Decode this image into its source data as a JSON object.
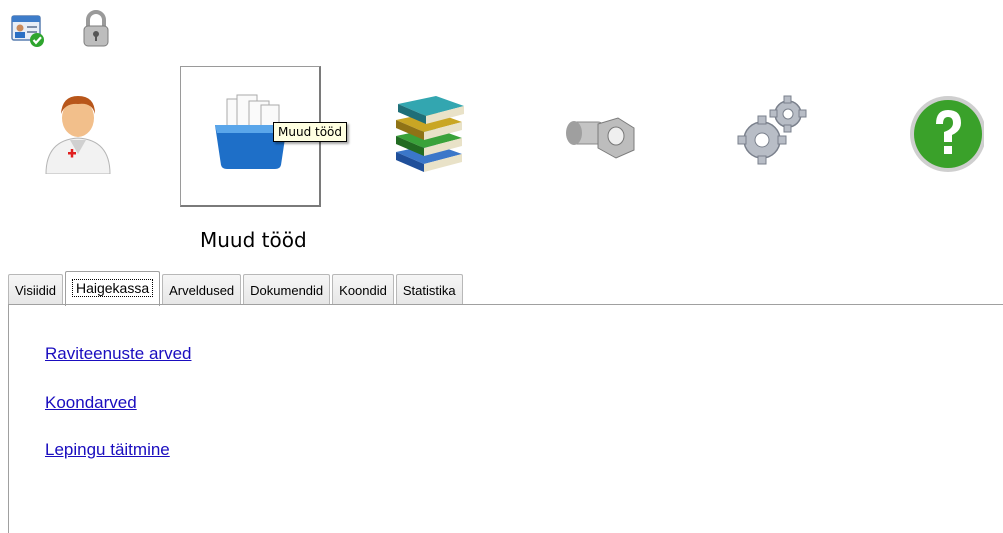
{
  "toolbar": {
    "small_icons": [
      "patient-card-icon",
      "lock-icon"
    ],
    "tiles": [
      {
        "name": "doctor-icon",
        "selected": false
      },
      {
        "name": "folder-icon",
        "selected": true
      },
      {
        "name": "books-icon",
        "selected": false
      },
      {
        "name": "bolt-nut-icon",
        "selected": false
      },
      {
        "name": "gears-icon",
        "selected": false
      },
      {
        "name": "help-icon",
        "selected": false
      }
    ],
    "tooltip": "Muud tööd"
  },
  "section_title": "Muud tööd",
  "tabs": [
    {
      "label": "Visiidid"
    },
    {
      "label": "Haigekassa",
      "active": true
    },
    {
      "label": "Arveldused"
    },
    {
      "label": "Dokumendid"
    },
    {
      "label": "Koondid"
    },
    {
      "label": "Statistika"
    }
  ],
  "links": [
    {
      "label": "Raviteenuste arved"
    },
    {
      "label": "Koondarved"
    },
    {
      "label": "Lepingu täitmine"
    }
  ],
  "colors": {
    "link": "#1a0dbf",
    "help_green": "#3aa12a",
    "folder_blue": "#1e6fc8"
  }
}
